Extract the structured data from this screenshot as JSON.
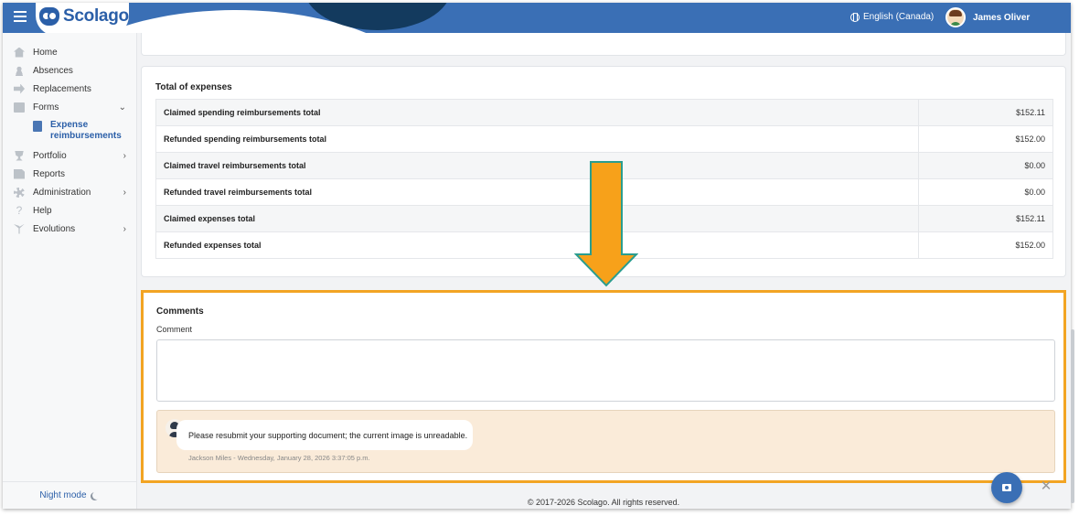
{
  "header": {
    "logo_text": "Scolago",
    "language": "English (Canada)",
    "user_name": "James Oliver"
  },
  "sidebar": {
    "items": [
      {
        "label": "Home",
        "icon": "home-icon"
      },
      {
        "label": "Absences",
        "icon": "person-icon"
      },
      {
        "label": "Replacements",
        "icon": "swap-icon"
      },
      {
        "label": "Forms",
        "icon": "form-icon",
        "expanded": true
      },
      {
        "label": "Portfolio",
        "icon": "trophy-icon"
      },
      {
        "label": "Reports",
        "icon": "report-icon"
      },
      {
        "label": "Administration",
        "icon": "gear-icon"
      },
      {
        "label": "Help",
        "icon": "help-icon"
      },
      {
        "label": "Evolutions",
        "icon": "plant-icon"
      }
    ],
    "sub_item_label": "Expense reimbursements",
    "night_mode": "Night mode"
  },
  "totals": {
    "title": "Total of expenses",
    "rows": [
      {
        "label": "Claimed spending reimbursements total",
        "value": "$152.11"
      },
      {
        "label": "Refunded spending reimbursements total",
        "value": "$152.00"
      },
      {
        "label": "Claimed travel reimbursements total",
        "value": "$0.00"
      },
      {
        "label": "Refunded travel reimbursements total",
        "value": "$0.00"
      },
      {
        "label": "Claimed expenses total",
        "value": "$152.11"
      },
      {
        "label": "Refunded expenses total",
        "value": "$152.00"
      }
    ]
  },
  "comments": {
    "title": "Comments",
    "field_label": "Comment",
    "field_value": "",
    "messages": [
      {
        "text": "Please resubmit your supporting document; the current image is unreadable.",
        "meta": "Jackson Miles - Wednesday, January 28, 2026 3:37:05 p.m."
      }
    ]
  },
  "footer": {
    "copyright": "© 2017-2026 Scolago. All rights reserved."
  },
  "colors": {
    "header_blue": "#3a6fb5",
    "highlight_orange": "#f2a423",
    "arrow_orange": "#f7a11a",
    "arrow_outline": "#2a9d8f",
    "comment_bg": "#faebd9"
  }
}
